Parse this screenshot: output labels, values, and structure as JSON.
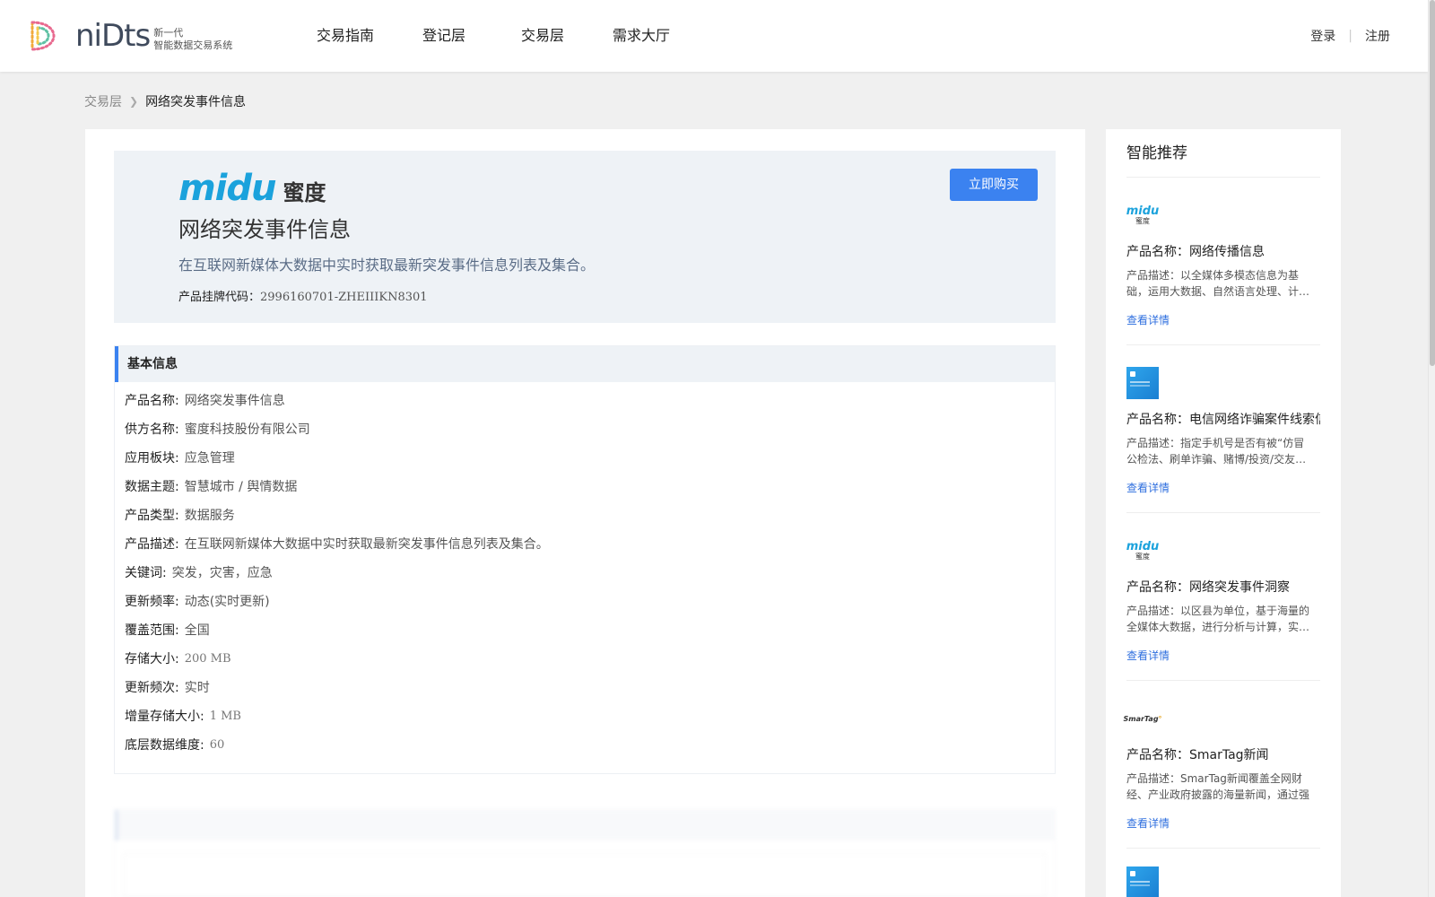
{
  "header": {
    "logo_word": "niDts",
    "logo_sub_1": "新一代",
    "logo_sub_2": "智能数据交易系统",
    "nav": [
      "交易指南",
      "登记层",
      "交易层",
      "需求大厅"
    ],
    "login": "登录",
    "register": "注册"
  },
  "breadcrumb": {
    "parent": "交易层",
    "current": "网络突发事件信息"
  },
  "product": {
    "brand_word": "midu",
    "brand_cn": "蜜度",
    "title": "网络突发事件信息",
    "description": "在互联网新媒体大数据中实时获取最新突发事件信息列表及集合。",
    "code_label": "产品挂牌代码：",
    "code_value": "2996160701-ZHEIIIKN8301",
    "buy_label": "立即购买"
  },
  "basic_info": {
    "heading": "基本信息",
    "rows": [
      {
        "key": "产品名称:",
        "value": "网络突发事件信息"
      },
      {
        "key": "供方名称:",
        "value": "蜜度科技股份有限公司"
      },
      {
        "key": "应用板块:",
        "value": "应急管理"
      },
      {
        "key": "数据主题:",
        "value": "智慧城市 / 舆情数据"
      },
      {
        "key": "产品类型:",
        "value": "数据服务"
      },
      {
        "key": "产品描述:",
        "value": "在互联网新媒体大数据中实时获取最新突发事件信息列表及集合。"
      },
      {
        "key": "关键词:",
        "value": "突发，灾害，应急"
      },
      {
        "key": "更新频率:",
        "value": "动态(实时更新)"
      },
      {
        "key": "覆盖范围:",
        "value": "全国"
      },
      {
        "key": "存储大小:",
        "value": "200 MB"
      },
      {
        "key": "更新频次:",
        "value": "实时"
      },
      {
        "key": "增量存储大小:",
        "value": "1 MB"
      },
      {
        "key": "底层数据维度:",
        "value": "60"
      }
    ]
  },
  "sidebar": {
    "title": "智能推荐",
    "items": [
      {
        "logo": "midu-logo",
        "name": "产品名称：网络传播信息",
        "desc": "产品描述：以全媒体多模态信息为基础，运用大数据、自然语言处理、计…",
        "link": "查看详情"
      },
      {
        "logo": "blue-thumbnail",
        "name": "产品名称：电信网络诈骗案件线索信",
        "desc": "产品描述：指定手机号是否有被“仿冒公检法、刷单诈骗、赌博/投资/交友…",
        "link": "查看详情"
      },
      {
        "logo": "midu-logo",
        "name": "产品名称：网络突发事件洞察",
        "desc": "产品描述：以区县为单位，基于海量的全媒体大数据，进行分析与计算，实…",
        "link": "查看详情"
      },
      {
        "logo": "smartag-logo",
        "name": "产品名称：SmarTag新闻",
        "desc": "产品描述：SmarTag新闻覆盖全网财经、产业政府披露的海量新闻，通过强大…",
        "link": "查看详情"
      }
    ]
  },
  "colors": {
    "accent": "#3b82f0",
    "brand": "#1ba2dc",
    "hero_bg": "#eef2f6"
  }
}
